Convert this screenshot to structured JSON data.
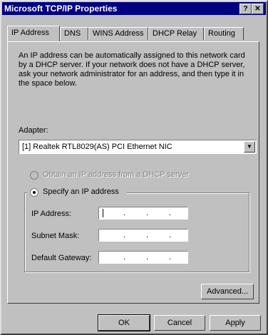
{
  "window": {
    "title": "Microsoft TCP/IP Properties",
    "help_glyph": "?",
    "close_glyph": "✕"
  },
  "tabs": [
    {
      "label": "IP Address",
      "active": true
    },
    {
      "label": "DNS"
    },
    {
      "label": "WINS Address"
    },
    {
      "label": "DHCP Relay"
    },
    {
      "label": "Routing"
    }
  ],
  "description": "An IP address can be automatically assigned to this network card by a DHCP server.  If your network does not have a DHCP server, ask your network administrator for an address, and then type it in the space below.",
  "adapter": {
    "label": "Adapter:",
    "selected": "[1] Realtek RTL8029(AS) PCI Ethernet NIC"
  },
  "options": {
    "obtain_label": "Obtain an IP address from a DHCP server",
    "specify_label": "Specify an IP address"
  },
  "fields": {
    "ip_label": "IP Address:",
    "subnet_label": "Subnet Mask:",
    "gateway_label": "Default Gateway:",
    "dot": "."
  },
  "buttons": {
    "advanced": "Advanced...",
    "ok": "OK",
    "cancel": "Cancel",
    "apply": "Apply"
  }
}
